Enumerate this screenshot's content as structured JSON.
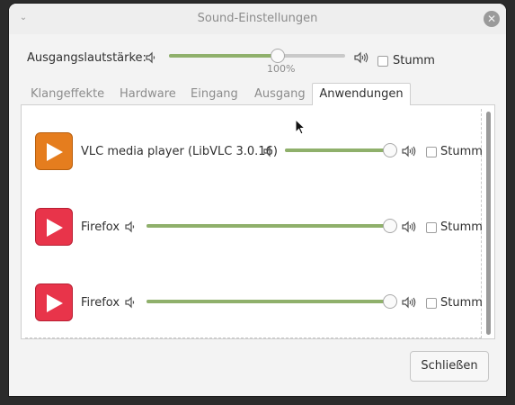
{
  "window": {
    "title": "Sound-Einstellungen"
  },
  "output": {
    "label": "Ausgangslautstärke:",
    "volume_percent_label": "100%",
    "volume_level": 0.62,
    "mute_label": "Stumm",
    "muted": false
  },
  "tabs": [
    {
      "label": "Klangeffekte",
      "active": false
    },
    {
      "label": "Hardware",
      "active": false
    },
    {
      "label": "Eingang",
      "active": false
    },
    {
      "label": "Ausgang",
      "active": false
    },
    {
      "label": "Anwendungen",
      "active": true
    }
  ],
  "applications": [
    {
      "name": "VLC media player (LibVLC 3.0.16)",
      "icon": "play-icon",
      "icon_color": "#e57d1e",
      "volume_level": 1.0,
      "mute_label": "Stumm",
      "muted": false
    },
    {
      "name": "Firefox",
      "icon": "play-icon",
      "icon_color": "#e8344a",
      "volume_level": 1.0,
      "mute_label": "Stumm",
      "muted": false
    },
    {
      "name": "Firefox",
      "icon": "play-icon",
      "icon_color": "#e8344a",
      "volume_level": 1.0,
      "mute_label": "Stumm",
      "muted": false
    }
  ],
  "footer": {
    "close_label": "Schließen"
  },
  "colors": {
    "accent": "#8fb06b",
    "window_bg": "#f3f3f3"
  }
}
